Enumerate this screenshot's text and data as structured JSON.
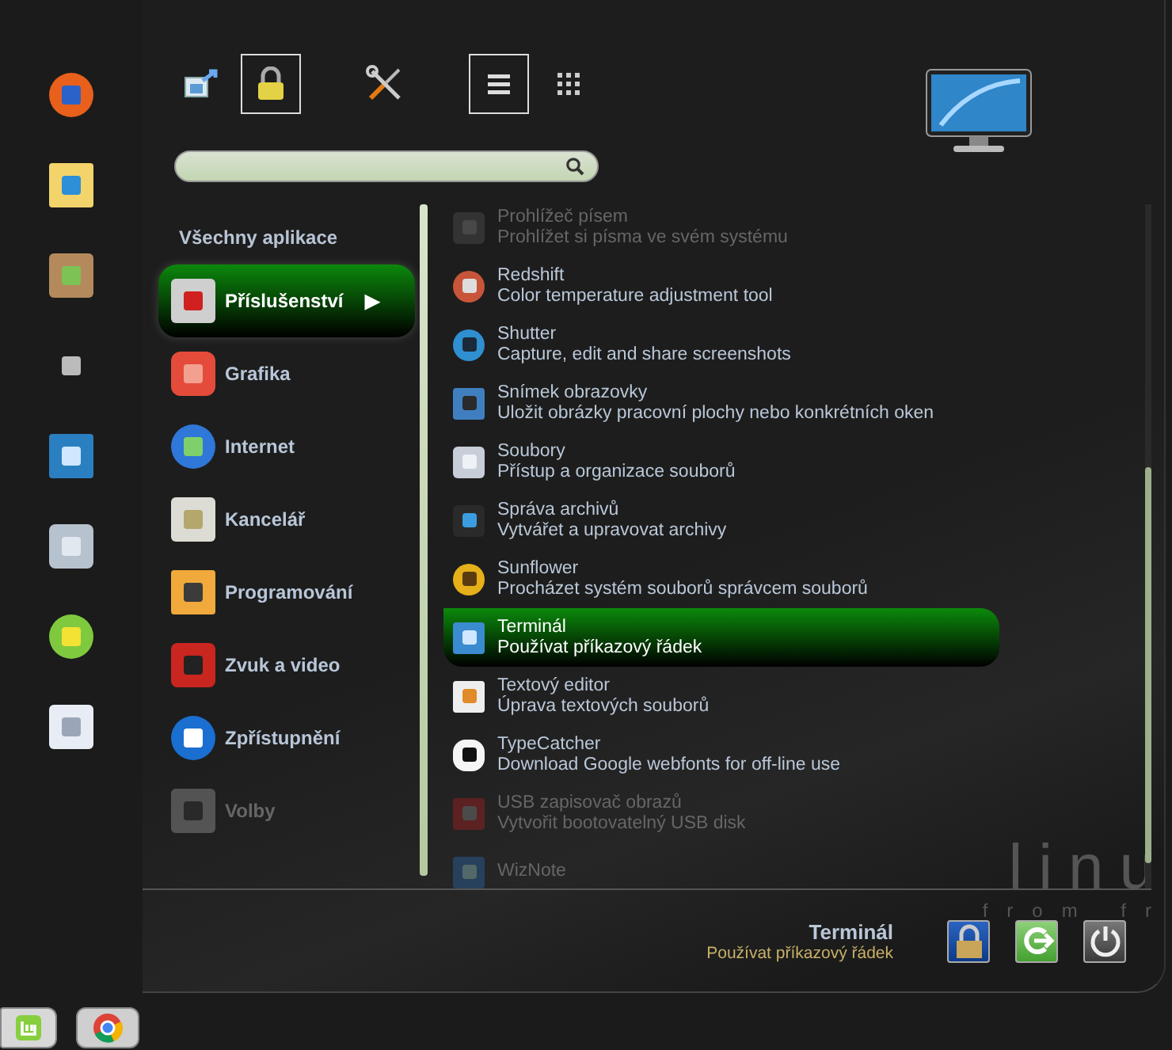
{
  "places_buttons": [
    {
      "selected": false
    },
    {
      "selected": true
    }
  ],
  "view_buttons": [
    {
      "selected": true
    },
    {
      "selected": false
    }
  ],
  "categories": {
    "heading": "Všechny aplikace",
    "open_marker": "▶",
    "items": [
      {
        "label": "Příslušenství",
        "selected": true,
        "faded": false
      },
      {
        "label": "Grafika",
        "selected": false,
        "faded": false
      },
      {
        "label": "Internet",
        "selected": false,
        "faded": false
      },
      {
        "label": "Kancelář",
        "selected": false,
        "faded": false
      },
      {
        "label": "Programování",
        "selected": false,
        "faded": false
      },
      {
        "label": "Zvuk a video",
        "selected": false,
        "faded": false
      },
      {
        "label": "Zpřístupnění",
        "selected": false,
        "faded": false
      },
      {
        "label": "Volby",
        "selected": false,
        "faded": true
      }
    ]
  },
  "apps": [
    {
      "name": "Prohlížeč písem",
      "description": "Prohlížet si písma ve svém systému",
      "selected": false,
      "faded": true
    },
    {
      "name": "Redshift",
      "description": "Color temperature adjustment tool",
      "selected": false,
      "faded": false
    },
    {
      "name": "Shutter",
      "description": "Capture, edit and share screenshots",
      "selected": false,
      "faded": false
    },
    {
      "name": "Snímek obrazovky",
      "description": "Uložit obrázky pracovní plochy nebo konkrétních oken",
      "selected": false,
      "faded": false
    },
    {
      "name": "Soubory",
      "description": "Přístup a organizace souborů",
      "selected": false,
      "faded": false
    },
    {
      "name": "Správa archivů",
      "description": "Vytvářet a upravovat archivy",
      "selected": false,
      "faded": false
    },
    {
      "name": "Sunflower",
      "description": "Procházet systém souborů správcem souborů",
      "selected": false,
      "faded": false
    },
    {
      "name": "Terminál",
      "description": "Používat příkazový řádek",
      "selected": true,
      "faded": false
    },
    {
      "name": "Textový editor",
      "description": "Úprava textových souborů",
      "selected": false,
      "faded": false
    },
    {
      "name": "TypeCatcher",
      "description": "Download Google webfonts for off-line use",
      "selected": false,
      "faded": false
    },
    {
      "name": "USB zapisovač obrazů",
      "description": "Vytvořit bootovatelný USB disk",
      "selected": false,
      "faded": true
    },
    {
      "name": "WizNote",
      "selected": false,
      "faded": true
    }
  ],
  "footer": {
    "title": "Terminál",
    "description": "Používat příkazový řádek"
  },
  "wallpaper": {
    "text_1": "linu",
    "text_2": "from fr"
  }
}
